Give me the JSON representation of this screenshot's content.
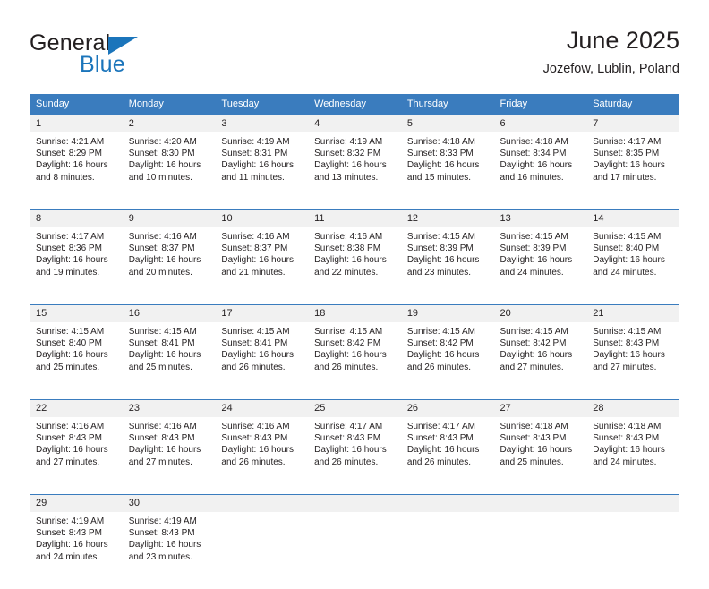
{
  "logo": {
    "word_top": "General",
    "word_bottom": "Blue",
    "triangle_color": "#1b75bb",
    "icon": "general-blue-logo"
  },
  "header": {
    "title": "June 2025",
    "location": "Jozefow, Lublin, Poland"
  },
  "theme": {
    "header_blue": "#3a7cbe",
    "daynum_band": "#f1f1f1",
    "text": "#231f20",
    "accent": "#1b75bb"
  },
  "calendar": {
    "weekday_headers": [
      "Sunday",
      "Monday",
      "Tuesday",
      "Wednesday",
      "Thursday",
      "Friday",
      "Saturday"
    ],
    "weeks": [
      [
        {
          "day": "1",
          "sunrise": "Sunrise: 4:21 AM",
          "sunset": "Sunset: 8:29 PM",
          "daylight": "Daylight: 16 hours and 8 minutes."
        },
        {
          "day": "2",
          "sunrise": "Sunrise: 4:20 AM",
          "sunset": "Sunset: 8:30 PM",
          "daylight": "Daylight: 16 hours and 10 minutes."
        },
        {
          "day": "3",
          "sunrise": "Sunrise: 4:19 AM",
          "sunset": "Sunset: 8:31 PM",
          "daylight": "Daylight: 16 hours and 11 minutes."
        },
        {
          "day": "4",
          "sunrise": "Sunrise: 4:19 AM",
          "sunset": "Sunset: 8:32 PM",
          "daylight": "Daylight: 16 hours and 13 minutes."
        },
        {
          "day": "5",
          "sunrise": "Sunrise: 4:18 AM",
          "sunset": "Sunset: 8:33 PM",
          "daylight": "Daylight: 16 hours and 15 minutes."
        },
        {
          "day": "6",
          "sunrise": "Sunrise: 4:18 AM",
          "sunset": "Sunset: 8:34 PM",
          "daylight": "Daylight: 16 hours and 16 minutes."
        },
        {
          "day": "7",
          "sunrise": "Sunrise: 4:17 AM",
          "sunset": "Sunset: 8:35 PM",
          "daylight": "Daylight: 16 hours and 17 minutes."
        }
      ],
      [
        {
          "day": "8",
          "sunrise": "Sunrise: 4:17 AM",
          "sunset": "Sunset: 8:36 PM",
          "daylight": "Daylight: 16 hours and 19 minutes."
        },
        {
          "day": "9",
          "sunrise": "Sunrise: 4:16 AM",
          "sunset": "Sunset: 8:37 PM",
          "daylight": "Daylight: 16 hours and 20 minutes."
        },
        {
          "day": "10",
          "sunrise": "Sunrise: 4:16 AM",
          "sunset": "Sunset: 8:37 PM",
          "daylight": "Daylight: 16 hours and 21 minutes."
        },
        {
          "day": "11",
          "sunrise": "Sunrise: 4:16 AM",
          "sunset": "Sunset: 8:38 PM",
          "daylight": "Daylight: 16 hours and 22 minutes."
        },
        {
          "day": "12",
          "sunrise": "Sunrise: 4:15 AM",
          "sunset": "Sunset: 8:39 PM",
          "daylight": "Daylight: 16 hours and 23 minutes."
        },
        {
          "day": "13",
          "sunrise": "Sunrise: 4:15 AM",
          "sunset": "Sunset: 8:39 PM",
          "daylight": "Daylight: 16 hours and 24 minutes."
        },
        {
          "day": "14",
          "sunrise": "Sunrise: 4:15 AM",
          "sunset": "Sunset: 8:40 PM",
          "daylight": "Daylight: 16 hours and 24 minutes."
        }
      ],
      [
        {
          "day": "15",
          "sunrise": "Sunrise: 4:15 AM",
          "sunset": "Sunset: 8:40 PM",
          "daylight": "Daylight: 16 hours and 25 minutes."
        },
        {
          "day": "16",
          "sunrise": "Sunrise: 4:15 AM",
          "sunset": "Sunset: 8:41 PM",
          "daylight": "Daylight: 16 hours and 25 minutes."
        },
        {
          "day": "17",
          "sunrise": "Sunrise: 4:15 AM",
          "sunset": "Sunset: 8:41 PM",
          "daylight": "Daylight: 16 hours and 26 minutes."
        },
        {
          "day": "18",
          "sunrise": "Sunrise: 4:15 AM",
          "sunset": "Sunset: 8:42 PM",
          "daylight": "Daylight: 16 hours and 26 minutes."
        },
        {
          "day": "19",
          "sunrise": "Sunrise: 4:15 AM",
          "sunset": "Sunset: 8:42 PM",
          "daylight": "Daylight: 16 hours and 26 minutes."
        },
        {
          "day": "20",
          "sunrise": "Sunrise: 4:15 AM",
          "sunset": "Sunset: 8:42 PM",
          "daylight": "Daylight: 16 hours and 27 minutes."
        },
        {
          "day": "21",
          "sunrise": "Sunrise: 4:15 AM",
          "sunset": "Sunset: 8:43 PM",
          "daylight": "Daylight: 16 hours and 27 minutes."
        }
      ],
      [
        {
          "day": "22",
          "sunrise": "Sunrise: 4:16 AM",
          "sunset": "Sunset: 8:43 PM",
          "daylight": "Daylight: 16 hours and 27 minutes."
        },
        {
          "day": "23",
          "sunrise": "Sunrise: 4:16 AM",
          "sunset": "Sunset: 8:43 PM",
          "daylight": "Daylight: 16 hours and 27 minutes."
        },
        {
          "day": "24",
          "sunrise": "Sunrise: 4:16 AM",
          "sunset": "Sunset: 8:43 PM",
          "daylight": "Daylight: 16 hours and 26 minutes."
        },
        {
          "day": "25",
          "sunrise": "Sunrise: 4:17 AM",
          "sunset": "Sunset: 8:43 PM",
          "daylight": "Daylight: 16 hours and 26 minutes."
        },
        {
          "day": "26",
          "sunrise": "Sunrise: 4:17 AM",
          "sunset": "Sunset: 8:43 PM",
          "daylight": "Daylight: 16 hours and 26 minutes."
        },
        {
          "day": "27",
          "sunrise": "Sunrise: 4:18 AM",
          "sunset": "Sunset: 8:43 PM",
          "daylight": "Daylight: 16 hours and 25 minutes."
        },
        {
          "day": "28",
          "sunrise": "Sunrise: 4:18 AM",
          "sunset": "Sunset: 8:43 PM",
          "daylight": "Daylight: 16 hours and 24 minutes."
        }
      ],
      [
        {
          "day": "29",
          "sunrise": "Sunrise: 4:19 AM",
          "sunset": "Sunset: 8:43 PM",
          "daylight": "Daylight: 16 hours and 24 minutes."
        },
        {
          "day": "30",
          "sunrise": "Sunrise: 4:19 AM",
          "sunset": "Sunset: 8:43 PM",
          "daylight": "Daylight: 16 hours and 23 minutes."
        },
        {
          "day": "",
          "sunrise": "",
          "sunset": "",
          "daylight": ""
        },
        {
          "day": "",
          "sunrise": "",
          "sunset": "",
          "daylight": ""
        },
        {
          "day": "",
          "sunrise": "",
          "sunset": "",
          "daylight": ""
        },
        {
          "day": "",
          "sunrise": "",
          "sunset": "",
          "daylight": ""
        },
        {
          "day": "",
          "sunrise": "",
          "sunset": "",
          "daylight": ""
        }
      ]
    ]
  }
}
